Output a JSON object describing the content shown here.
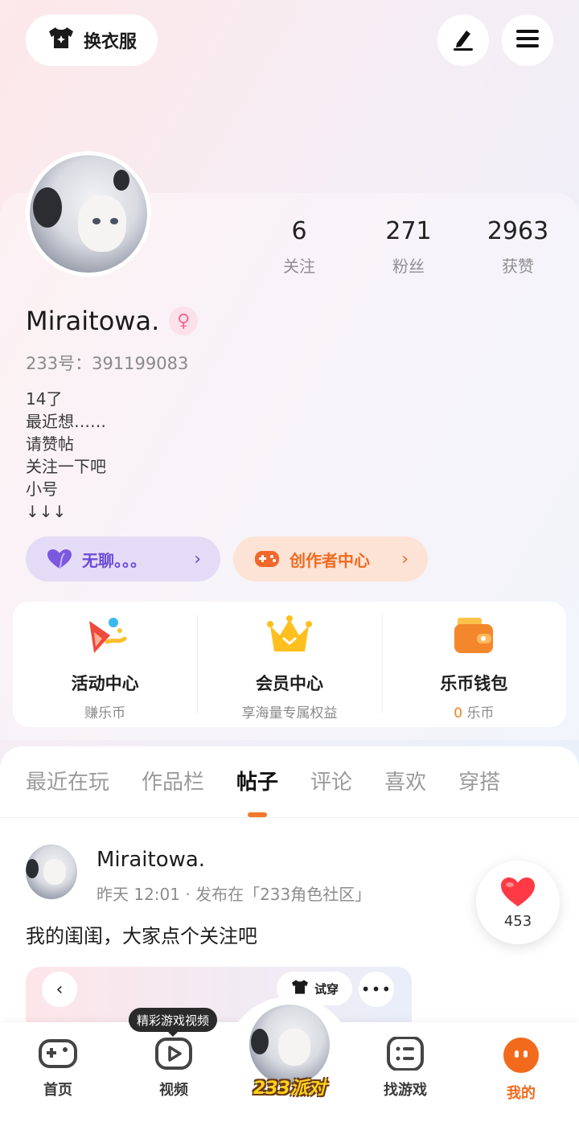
{
  "header": {
    "dress_label": "换衣服",
    "dress_icon": "tshirt-icon",
    "edit_icon": "pencil-icon",
    "menu_icon": "hamburger-menu-icon"
  },
  "profile": {
    "stats": [
      {
        "num": "6",
        "label": "关注"
      },
      {
        "num": "271",
        "label": "粉丝"
      },
      {
        "num": "2963",
        "label": "获赞"
      }
    ],
    "username": "Miraitowa.",
    "gender_symbol": "♀",
    "uid": "233号：391199083",
    "bio": "14了\n最近想……\n请赞帖\n关注一下吧\n小号\n↓↓↓",
    "mood_label": "无聊。。。",
    "creator_label": "创作者中心",
    "chevron": "›"
  },
  "features": [
    {
      "title": "活动中心",
      "sub": "赚乐币"
    },
    {
      "title": "会员中心",
      "sub": "享海量专属权益"
    },
    {
      "title": "乐币钱包",
      "sub_count": "0",
      "sub": "乐币"
    }
  ],
  "tabs": [
    "最近在玩",
    "作品栏",
    "帖子",
    "评论",
    "喜欢",
    "穿搭"
  ],
  "active_tab": 2,
  "post": {
    "author": "Miraitowa.",
    "meta": "昨天 12:01 · 发布在「233角色社区」",
    "text": "我的闺闺，大家点个关注吧",
    "likes": "453",
    "try_label": "试穿",
    "back_glyph": "‹",
    "more_glyph": "•••"
  },
  "bottom_nav": {
    "tooltip": "精彩游戏视频",
    "items": [
      {
        "label": "首页",
        "icon": "gamepad-icon"
      },
      {
        "label": "视频",
        "icon": "play-icon"
      },
      {
        "label": "找游戏",
        "icon": "list-icon"
      },
      {
        "label": "我的",
        "icon": "face-icon"
      }
    ],
    "center_badge": "233派对"
  },
  "colors": {
    "accent": "#f26a1b",
    "purple": "#6a4bd8"
  }
}
